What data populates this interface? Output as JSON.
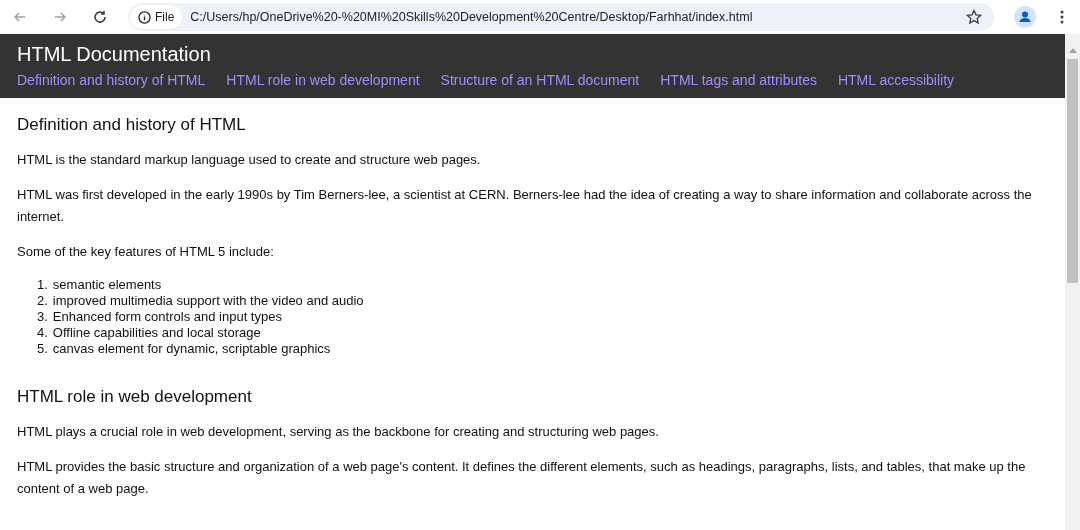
{
  "browser": {
    "file_label": "File",
    "url": "C:/Users/hp/OneDrive%20-%20MI%20Skills%20Development%20Centre/Desktop/Farhhat/index.html"
  },
  "header": {
    "title": "HTML Documentation",
    "nav": [
      "Definition and history of HTML",
      "HTML role in web development",
      "Structure of an HTML document",
      "HTML tags and attributes",
      "HTML accessibility"
    ]
  },
  "sections": [
    {
      "heading": "Definition and history of HTML",
      "blocks": [
        {
          "kind": "paragraph",
          "text": "HTML is the standard markup language used to create and structure web pages."
        },
        {
          "kind": "paragraph",
          "text": "HTML was first developed in the early 1990s by Tim Berners-lee, a scientist at CERN. Berners-lee had the idea of creating a way to share information and collaborate across the internet."
        },
        {
          "kind": "paragraph",
          "text": "Some of the key features of HTML 5 include:"
        },
        {
          "kind": "list",
          "items": [
            {
              "number": "1.",
              "text": "semantic elements"
            },
            {
              "number": "2.",
              "text": "improved multimedia support with the video and audio"
            },
            {
              "number": "3.",
              "text": "Enhanced form controls and input types"
            },
            {
              "number": "4.",
              "text": "Offline capabilities and local storage"
            },
            {
              "number": "5.",
              "text": "canvas element for dynamic, scriptable graphics"
            }
          ]
        }
      ]
    },
    {
      "heading": "HTML role in web development",
      "blocks": [
        {
          "kind": "paragraph",
          "text": "HTML plays a crucial role in web development, serving as the backbone for creating and structuring web pages."
        },
        {
          "kind": "paragraph",
          "text": "HTML provides the basic structure and organization of a web page's content. It defines the different elements, such as headings, paragraphs, lists, and tables, that make up the content of a web page."
        }
      ]
    }
  ]
}
